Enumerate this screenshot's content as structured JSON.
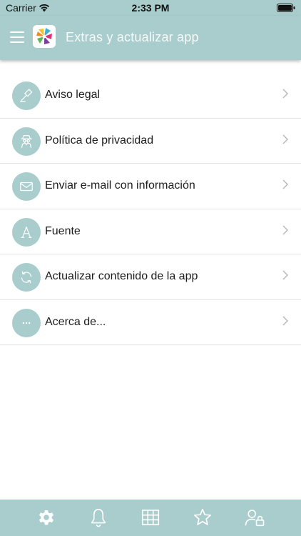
{
  "status_bar": {
    "carrier": "Carrier",
    "time": "2:33 PM"
  },
  "app_bar": {
    "title": "Extras y actualizar app",
    "menu_icon": "hamburger-icon"
  },
  "colors": {
    "accent": "#a9cdcd",
    "divider": "#e3e3e3",
    "text": "#1d1d1d"
  },
  "menu": {
    "items": [
      {
        "label": "Aviso legal",
        "icon": "gavel-icon"
      },
      {
        "label": "Política de privacidad",
        "icon": "spy-icon"
      },
      {
        "label": "Enviar e-mail con información",
        "icon": "envelope-icon"
      },
      {
        "label": "Fuente",
        "icon": "font-icon"
      },
      {
        "label": "Actualizar contenido de la app",
        "icon": "refresh-icon"
      },
      {
        "label": "Acerca de...",
        "icon": "more-icon"
      }
    ]
  },
  "bottom_tabs": [
    {
      "icon": "gear-icon",
      "active": true
    },
    {
      "icon": "bell-icon",
      "active": false
    },
    {
      "icon": "grid-icon",
      "active": false
    },
    {
      "icon": "star-icon",
      "active": false
    },
    {
      "icon": "user-lock-icon",
      "active": false
    }
  ]
}
